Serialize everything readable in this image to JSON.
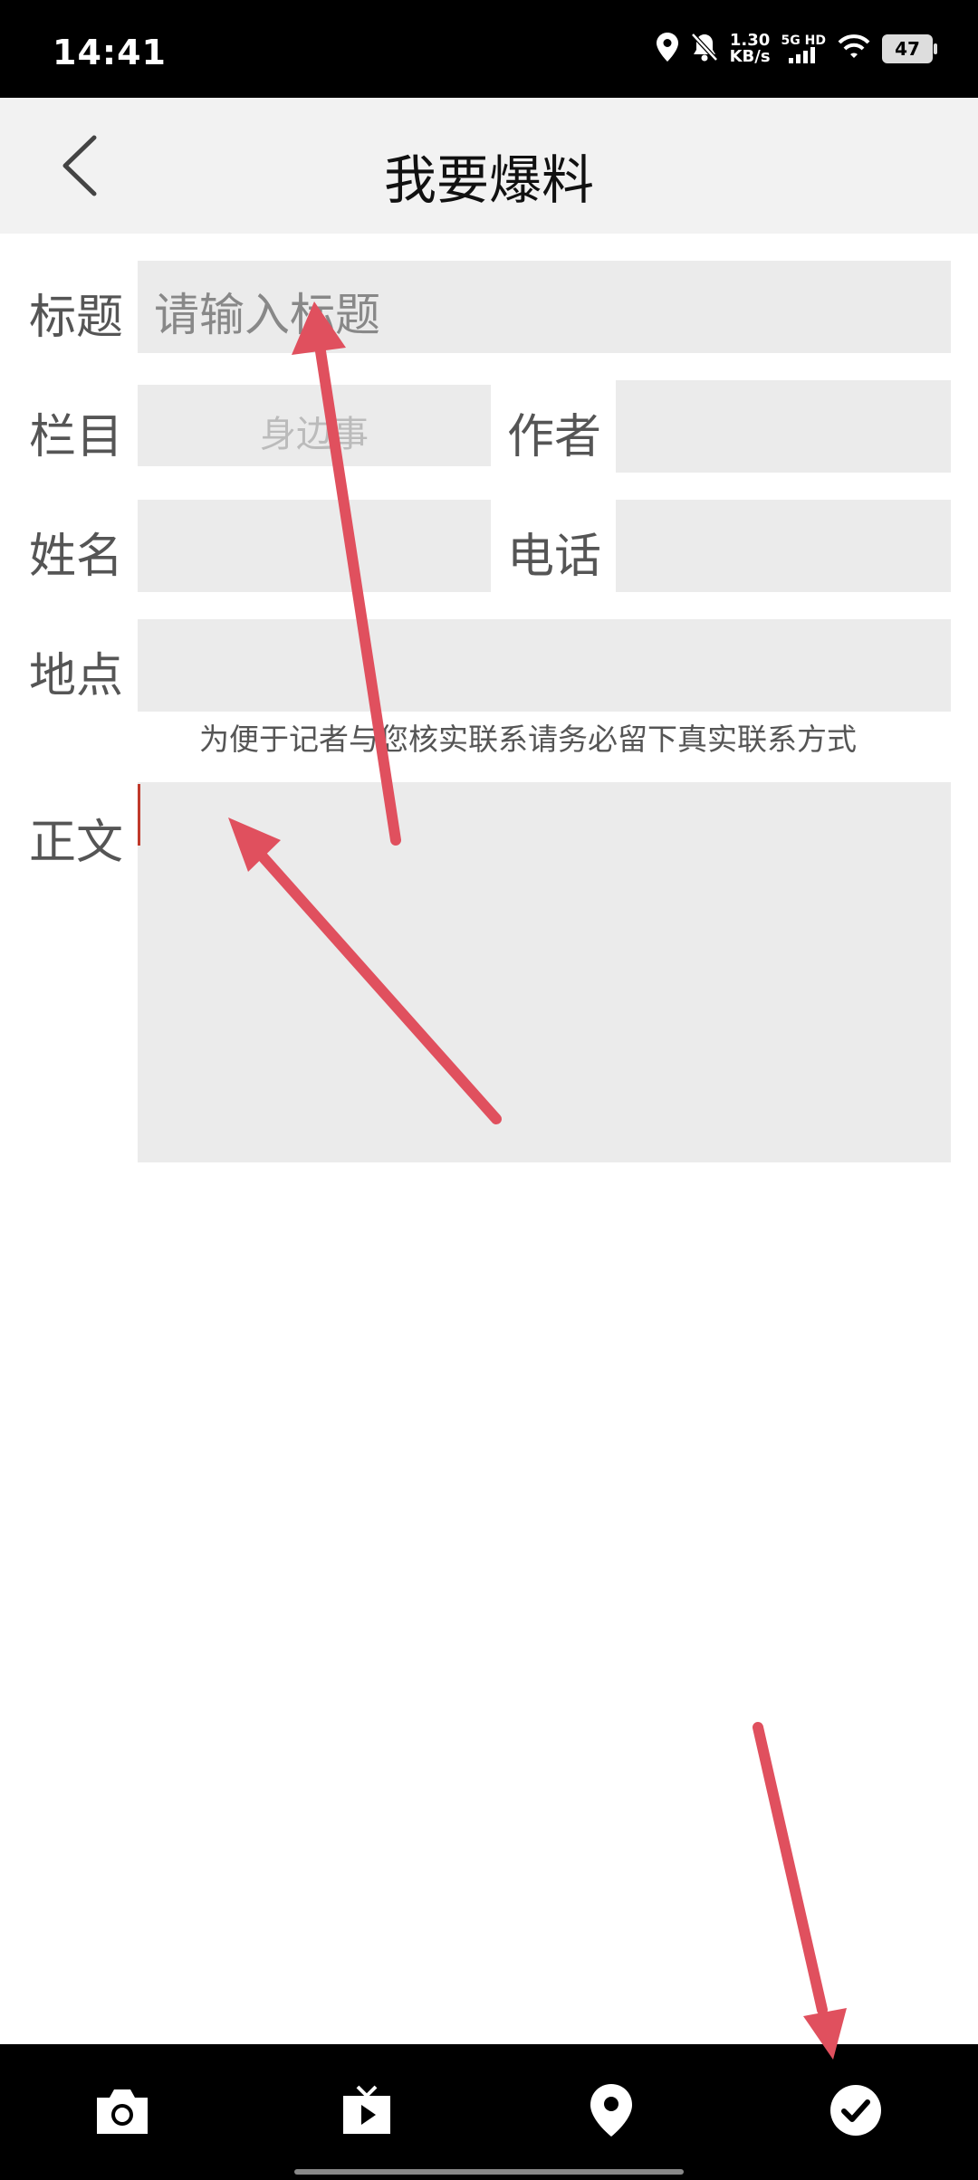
{
  "status_bar": {
    "time": "14:41",
    "net_speed_value": "1.30",
    "net_speed_unit": "KB/s",
    "signal_label": "5G HD",
    "battery": "47",
    "icons": [
      "location-icon",
      "bell-muted-icon",
      "signal-icon",
      "wifi-icon",
      "battery-icon"
    ]
  },
  "header": {
    "title": "我要爆料",
    "back_icon": "chevron-left-icon"
  },
  "form": {
    "title_label": "标题",
    "title_placeholder": "请输入标题",
    "column_label": "栏目",
    "column_value": "身边事",
    "author_label": "作者",
    "author_value": "",
    "name_label": "姓名",
    "name_value": "",
    "phone_label": "电话",
    "phone_value": "",
    "location_label": "地点",
    "location_value": "",
    "contact_hint": "为便于记者与您核实联系请务必留下真实联系方式",
    "body_label": "正文",
    "body_value": ""
  },
  "toolbar": {
    "items": [
      "camera-icon",
      "video-icon",
      "location-pin-icon",
      "check-icon"
    ]
  },
  "colors": {
    "field_bg": "#ebebeb",
    "header_bg": "#f2f2f2",
    "annotation_arrow": "#e0505e",
    "caret": "#c0392b"
  }
}
